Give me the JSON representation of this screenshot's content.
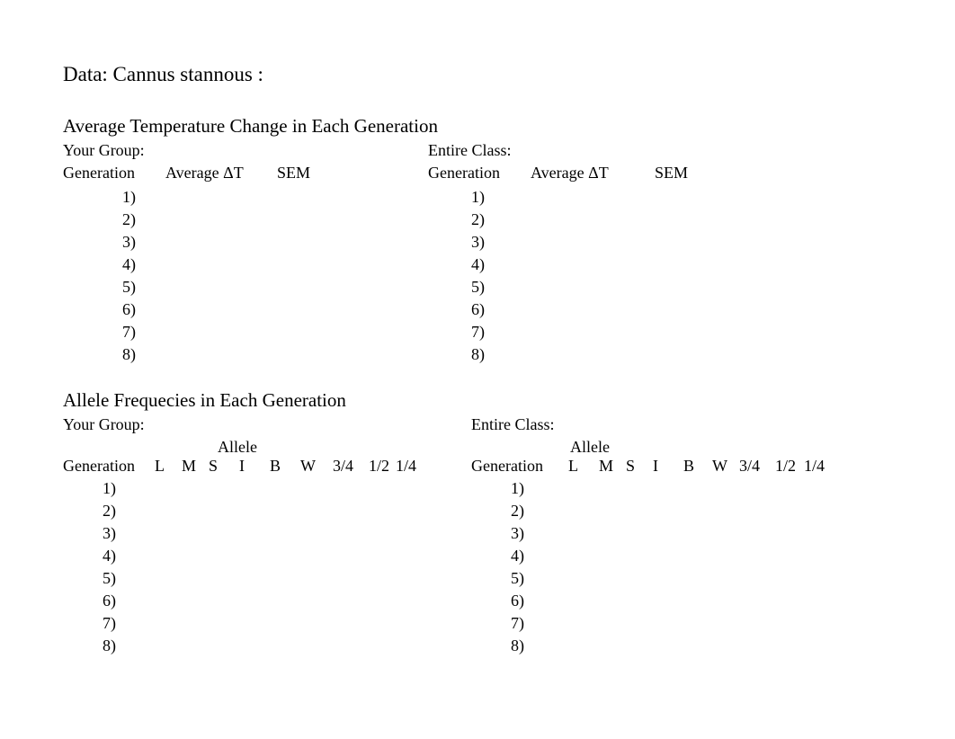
{
  "title": "Data: Cannus stannous :",
  "temp_section_title": "Average Temperature Change in Each Generation",
  "allele_section_title": "Allele Frequecies in Each Generation",
  "your_group_label": "Your Group:",
  "entire_class_label": "Entire Class:",
  "col_generation": "Generation",
  "col_avg_dt": "Average ΔT",
  "col_sem": "SEM",
  "allele_label": "Allele",
  "allele_cols": {
    "L": "L",
    "M": "M",
    "S": "S",
    "I": "I",
    "B": "B",
    "W": "W",
    "three_quarter": "3/4",
    "half": "1/2",
    "quarter": "1/4"
  },
  "generations": [
    "1)",
    "2)",
    "3)",
    "4)",
    "5)",
    "6)",
    "7)",
    "8)"
  ]
}
